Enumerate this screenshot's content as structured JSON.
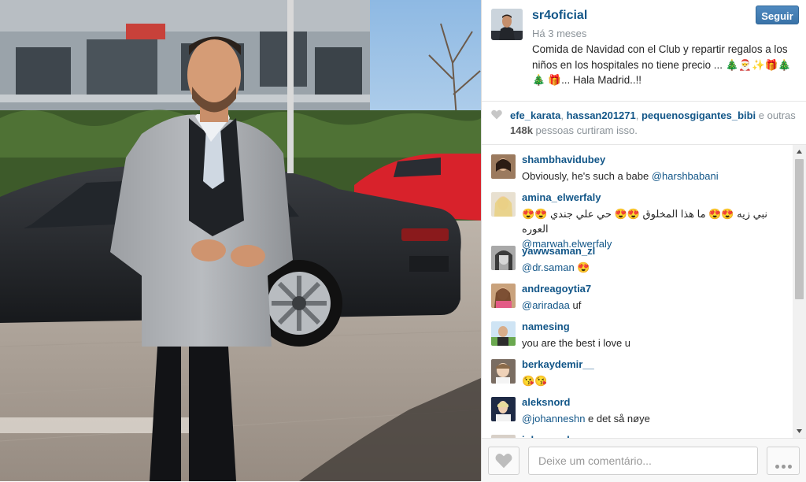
{
  "post": {
    "username": "sr4oficial",
    "time_ago": "Há 3 meses",
    "caption": "Comida de Navidad con el Club y repartir regalos a los niños en los hospitales no tiene precio ... 🎄🎅✨🎁🎄🎄 🎁... Hala Madrid..!!",
    "follow_label": "Seguir"
  },
  "likes": {
    "user1": "efe_karata",
    "sep1": ", ",
    "user2": "hassan201271",
    "sep2": ", ",
    "user3": "pequenosgigantes_bibi",
    "joiner": " e outras ",
    "count": "148k",
    "suffix": " pessoas curtiram isso."
  },
  "comments": [
    {
      "user": "shambhavidubey",
      "text": "Obviously, he's such a babe ",
      "mention": "@harshbabani"
    },
    {
      "user": "amina_elwerfaly",
      "text": "😍😍 نبي زيه 😍😍 ما هذا المخلوق 😍😍 حي علي جندي العوره",
      "mention": "@marwah.elwerfaly",
      "mention_first_line": false
    },
    {
      "user": "yawwsaman_zl",
      "text": " 😍",
      "mention": "@dr.saman",
      "mention_first": true
    },
    {
      "user": "andreagoytia7",
      "text": " uf",
      "mention": "@ariradaa",
      "mention_first": true
    },
    {
      "user": "namesing",
      "text": "you are the best i love u",
      "mention": ""
    },
    {
      "user": "berkaydemir__",
      "text": "😘😘",
      "mention": ""
    },
    {
      "user": "aleksnord",
      "text": " e det så nøye",
      "mention": "@johanneshn",
      "mention_first": true
    },
    {
      "user": "johanneshn",
      "text": "",
      "mention": ""
    }
  ],
  "footer": {
    "comment_placeholder": "Deixe um comentário..."
  },
  "colors": {
    "link": "#125688",
    "follow_button": "#3a73a8",
    "muted_text": "#8a9298"
  },
  "icons": [
    "heart-icon",
    "more-options-icon",
    "scroll-up-icon",
    "scroll-down-icon"
  ]
}
